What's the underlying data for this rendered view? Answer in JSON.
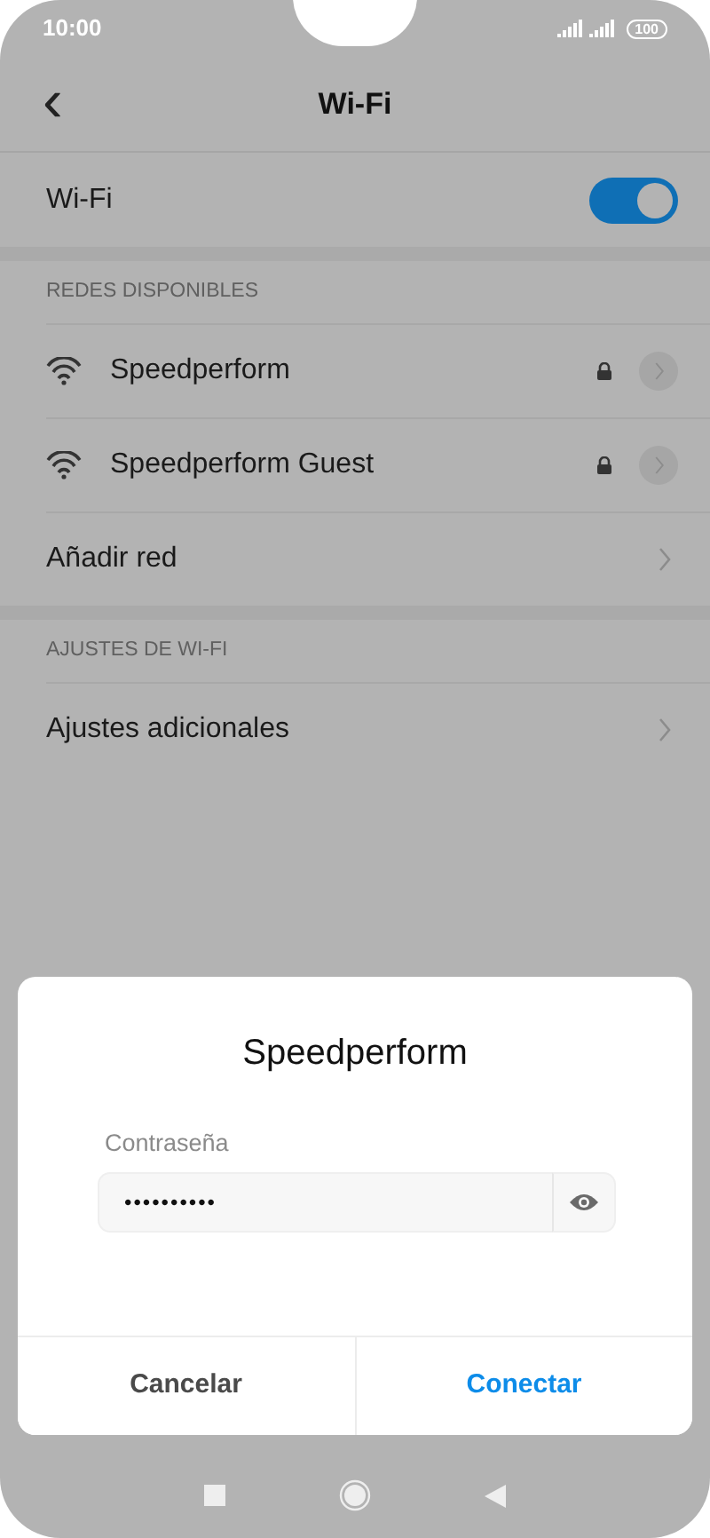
{
  "status_bar": {
    "time": "10:00",
    "battery": "100"
  },
  "header": {
    "back": "‹",
    "title": "Wi-Fi"
  },
  "wifi_toggle": {
    "label": "Wi-Fi",
    "on": true
  },
  "sections": [
    {
      "title": "REDES DISPONIBLES",
      "items": [
        {
          "kind": "network",
          "label": "Speedperform",
          "locked": true
        },
        {
          "kind": "network",
          "label": "Speedperform Guest",
          "locked": true
        },
        {
          "kind": "link",
          "label": "Añadir red"
        }
      ]
    },
    {
      "title": "AJUSTES DE WI-FI",
      "items": [
        {
          "kind": "link",
          "label": "Ajustes adicionales"
        }
      ]
    }
  ],
  "dialog": {
    "title": "Speedperform",
    "field_label": "Contraseña",
    "value": "••••••••••",
    "buttons": [
      {
        "label": "Cancelar",
        "primary": false
      },
      {
        "label": "Conectar",
        "primary": true
      }
    ]
  }
}
